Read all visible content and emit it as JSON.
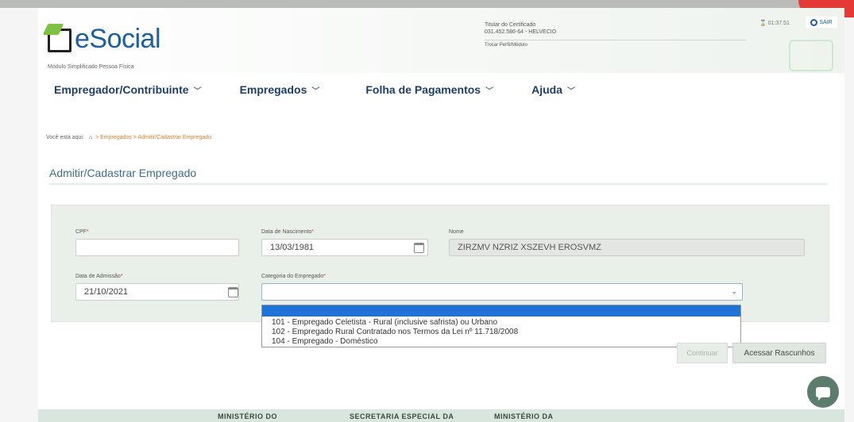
{
  "header": {
    "logo_text": "eSocial",
    "logo_subtitle": "Módulo Simplificado Pessoa Física",
    "cert_label": "Titular do Certificado",
    "cert_value": "031.452.586-64 - HELVECIO",
    "switch_profile": "Trocar Perfil/Módulo",
    "timer": "01:37:51",
    "logout_label": "SAIR"
  },
  "nav": {
    "items": [
      {
        "label": "Empregador/Contribuinte"
      },
      {
        "label": "Empregados"
      },
      {
        "label": "Folha de Pagamentos"
      },
      {
        "label": "Ajuda"
      }
    ]
  },
  "breadcrumb": {
    "prefix": "Você está aqui:",
    "trail": "> Empregados > Admitir/Cadastrar Empregado"
  },
  "page_title": "Admitir/Cadastrar Empregado",
  "form": {
    "cpf_label": "CPF",
    "cpf_value": "",
    "birth_label": "Data de Nascimento",
    "birth_value": "13/03/1981",
    "name_label": "Nome",
    "name_value": "ZIRZMV NZRIZ XSZEVH EROSVMZ",
    "admission_label": "Data de Admissão",
    "admission_value": "21/10/2021",
    "category_label": "Categoria do Empregado",
    "category_value": "",
    "required_mark": "*"
  },
  "dropdown": {
    "options": [
      "",
      "101 - Empregado Celetista - Rural (inclusive safrista) ou Urbano",
      "102 - Empregado Rural Contratado nos Termos da Lei nº 11.718/2008",
      "104 - Empregado - Doméstico"
    ],
    "highlighted_index": 0
  },
  "buttons": {
    "continue": "Continuar",
    "drafts": "Acessar Rascunhos"
  },
  "footer": {
    "col1": "MINISTÉRIO DO",
    "col2": "SECRETARIA ESPECIAL DA",
    "col3": "MINISTÉRIO DA"
  },
  "colors": {
    "brand_blue": "#1b5fa3",
    "brand_green": "#7dc242",
    "nav_text": "#1f3e66",
    "highlight": "#1e73d8"
  }
}
